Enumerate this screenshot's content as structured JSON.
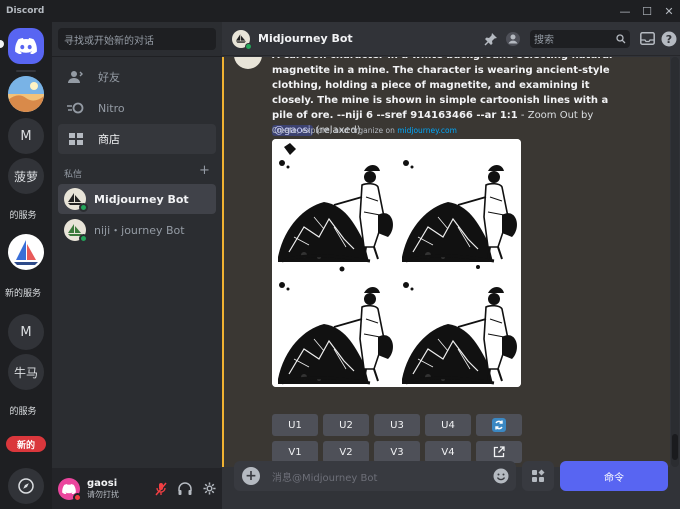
{
  "window": {
    "title": "Discord",
    "controls": [
      "—",
      "☐",
      "✕"
    ]
  },
  "guilds": {
    "items": [
      {
        "type": "letter",
        "label": "M"
      },
      {
        "type": "text",
        "label": "菠萝"
      },
      {
        "type": "truncated",
        "label": "的服务"
      },
      {
        "type": "truncated",
        "label": "新的服务"
      },
      {
        "type": "letter",
        "label": "M"
      },
      {
        "type": "text",
        "label": "牛马"
      },
      {
        "type": "truncated",
        "label": "的服务"
      }
    ],
    "new_badge": "新的"
  },
  "dm_sidebar": {
    "search_placeholder": "寻找或开始新的对话",
    "nav": [
      {
        "label": "好友",
        "icon": "friends-icon"
      },
      {
        "label": "Nitro",
        "icon": "nitro-icon"
      },
      {
        "label": "商店",
        "icon": "shop-icon"
      }
    ],
    "section_label": "私信",
    "section_add": "+",
    "dms": [
      {
        "label": "Midjourney Bot",
        "active": true
      },
      {
        "label": "niji・journey Bot",
        "active": false
      }
    ]
  },
  "user": {
    "name": "gaosi",
    "status": "请勿打扰"
  },
  "header": {
    "title": "Midjourney Bot",
    "search_placeholder": "搜索"
  },
  "message": {
    "prompt": "A cartoon character in a white background selecting natural magnetite in a mine. The character is wearing ancient-style clothing, holding a piece of magnetite, and examining it closely. The mine is shown in simple cartoonish lines with a pile of ore. --niji 6 --sref 914163466 --ar 1:1",
    "suffix_before": " - Zoom Out by ",
    "mention": "@gaosi",
    "suffix_after": " (relaxed)",
    "subtext_prefix": "Create, explore, and organize on ",
    "subtext_link": "midjourney.com"
  },
  "buttons": {
    "row1": [
      "U1",
      "U2",
      "U3",
      "U4"
    ],
    "row2": [
      "V1",
      "V2",
      "V3",
      "V4"
    ]
  },
  "composer": {
    "placeholder": "消息@Midjourney Bot",
    "command_label": "命令"
  }
}
